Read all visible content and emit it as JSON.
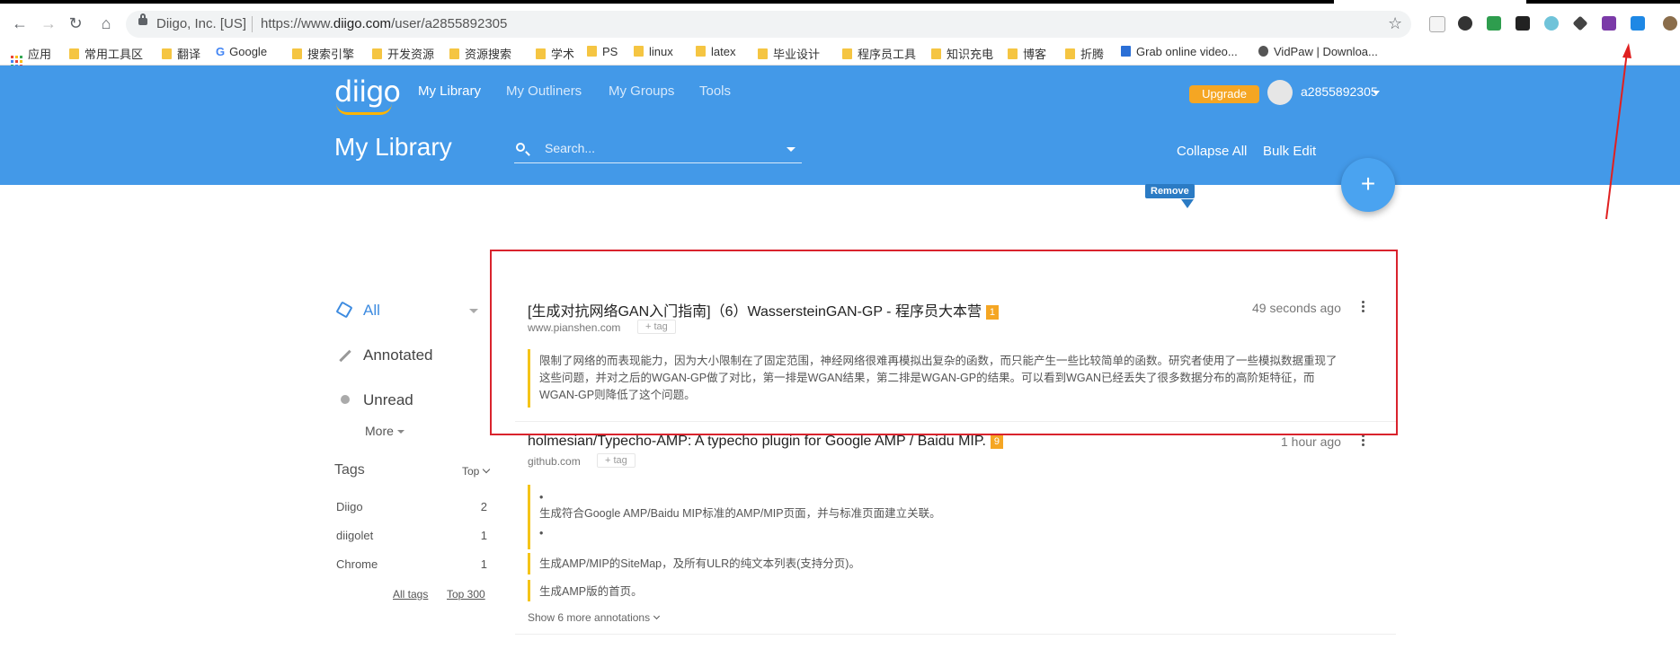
{
  "browser": {
    "site_identity": "Diigo, Inc. [US]",
    "url_prefix": "https://www.",
    "url_domain": "diigo.com",
    "url_path": "/user/a2855892305"
  },
  "bookmarks": [
    {
      "label": "应用",
      "type": "apps"
    },
    {
      "label": "常用工具区",
      "type": "folder"
    },
    {
      "label": "翻译",
      "type": "folder"
    },
    {
      "label": "Google",
      "type": "google"
    },
    {
      "label": "搜索引擎",
      "type": "folder"
    },
    {
      "label": "开发资源",
      "type": "folder"
    },
    {
      "label": "资源搜索",
      "type": "folder"
    },
    {
      "label": "学术",
      "type": "folder"
    },
    {
      "label": "PS",
      "type": "folder"
    },
    {
      "label": "linux",
      "type": "folder"
    },
    {
      "label": "latex",
      "type": "folder"
    },
    {
      "label": "毕业设计",
      "type": "folder"
    },
    {
      "label": "程序员工具",
      "type": "folder"
    },
    {
      "label": "知识充电",
      "type": "folder"
    },
    {
      "label": "博客",
      "type": "folder"
    },
    {
      "label": "折腾",
      "type": "folder"
    },
    {
      "label": "Grab online video...",
      "type": "page"
    },
    {
      "label": "VidPaw | Downloa...",
      "type": "page"
    }
  ],
  "header": {
    "logo": "diigo",
    "nav": [
      "My Library",
      "My Outliners",
      "My Groups",
      "Tools"
    ],
    "upgrade_label": "Upgrade",
    "username": "a2855892305",
    "page_title": "My Library",
    "search_placeholder": "Search...",
    "collapse_all": "Collapse All",
    "bulk_edit": "Bulk Edit",
    "add_label": "+",
    "remove_tooltip": "Remove"
  },
  "sidebar": {
    "filters": [
      {
        "label": "All",
        "icon": "cube-icon"
      },
      {
        "label": "Annotated",
        "icon": "pencil-icon"
      },
      {
        "label": "Unread",
        "icon": "dot-icon"
      }
    ],
    "more_label": "More",
    "tags_title": "Tags",
    "tags_sort": "Top",
    "tags": [
      {
        "name": "Diigo",
        "count": "2"
      },
      {
        "name": "diigolet",
        "count": "1"
      },
      {
        "name": "Chrome",
        "count": "1"
      }
    ],
    "all_tags": "All tags",
    "top_300": "Top 300"
  },
  "items": [
    {
      "title": "[生成对抗网络GAN入门指南]（6）WassersteinGAN-GP - 程序员大本营",
      "badge": "1",
      "domain": "www.pianshen.com",
      "tag_label": "+ tag",
      "time": "49 seconds ago",
      "annotations": [
        "限制了网络的而表现能力，因为大小限制在了固定范围，神经网络很难再模拟出复杂的函数，而只能产生一些比较简单的函数。研究者使用了一些模拟数据重现了这些问题，并对之后的WGAN-GP做了对比，第一排是WGAN结果，第二排是WGAN-GP的结果。可以看到WGAN已经丢失了很多数据分布的高阶矩特征，而WGAN-GP则降低了这个问题。"
      ]
    },
    {
      "title": "holmesian/Typecho-AMP: A typecho plugin for Google AMP / Baidu MIP.",
      "badge": "9",
      "domain": "github.com",
      "tag_label": "+ tag",
      "time": "1 hour ago",
      "annotations": [
        "•",
        "生成符合Google AMP/Baidu MIP标准的AMP/MIP页面，并与标准页面建立关联。",
        "•",
        "生成AMP/MIP的SiteMap，及所有ULR的纯文本列表(支持分页)。",
        "生成AMP版的首页。"
      ],
      "show_more": "Show 6 more annotations"
    }
  ],
  "colors": {
    "header_blue": "#4399e8",
    "upgrade_orange": "#f5a623",
    "highlight_red": "#d9232d",
    "quote_yellow": "#f5c418"
  }
}
